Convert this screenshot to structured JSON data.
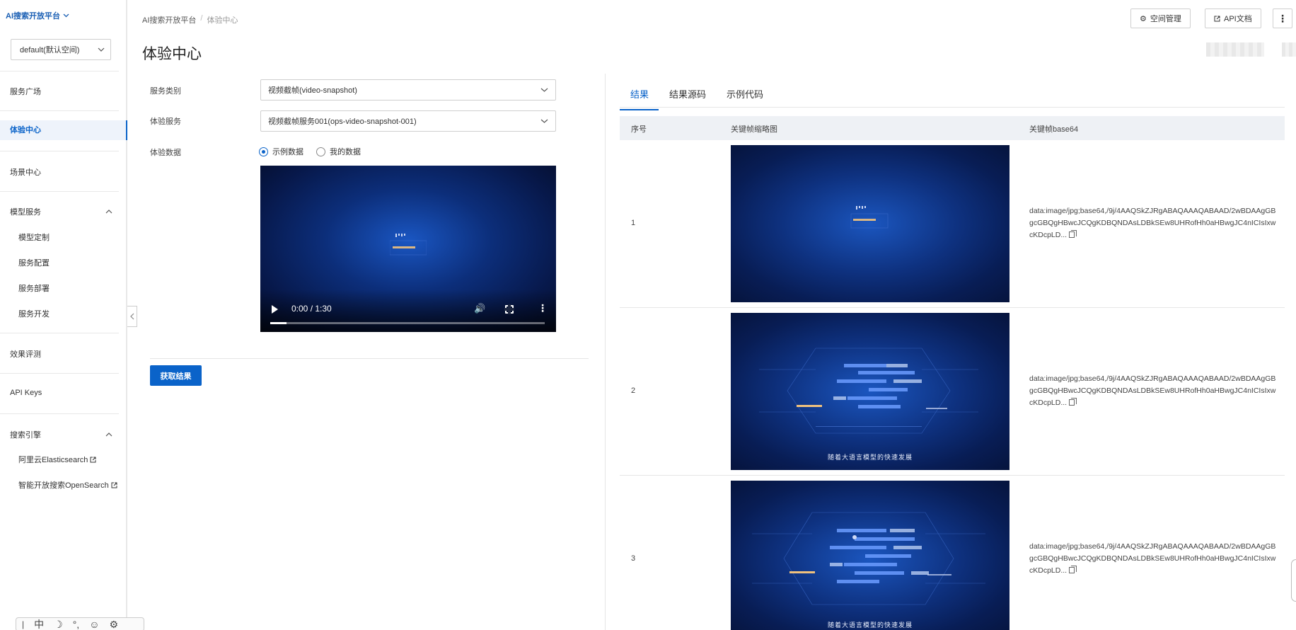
{
  "sidebar": {
    "brand": "AI搜索开放平台",
    "space": "default(默认空间)",
    "items": {
      "service_plaza": "服务广场",
      "experience_center": "体验中心",
      "scene_center": "场景中心",
      "model_service": "模型服务",
      "model_custom": "模型定制",
      "service_config": "服务配置",
      "service_deploy": "服务部署",
      "service_dev": "服务开发",
      "eval": "效果评测",
      "api_keys": "API Keys",
      "search_engine": "搜索引擎",
      "elasticsearch": "阿里云Elasticsearch",
      "opensearch": "智能开放搜索OpenSearch"
    }
  },
  "header": {
    "breadcrumb_root": "AI搜索开放平台",
    "breadcrumb_sep": "/",
    "breadcrumb_current": "体验中心",
    "title": "体验中心",
    "space_manage": "空间管理",
    "api_doc": "API文档",
    "more": "⋮"
  },
  "form": {
    "service_type_label": "服务类别",
    "service_type_value": "视频截帧(video-snapshot)",
    "service_label": "体验服务",
    "service_value": "视频截帧服务001(ops-video-snapshot-001)",
    "data_label": "体验数据",
    "radio_sample": "示例数据",
    "radio_mine": "我的数据",
    "video_time": "0:00 / 1:30",
    "video_progress": 0.06,
    "submit": "获取结果"
  },
  "results": {
    "tabs": [
      "结果",
      "结果源码",
      "示例代码"
    ],
    "columns": [
      "序号",
      "关键帧缩略图",
      "关键帧base64"
    ],
    "rows": [
      {
        "index": "1",
        "base64": "data:image/jpg;base64,/9j/4AAQSkZJRgABAQAAAQABAAD/2wBDAAgGBgcGBQgHBwcJCQgKDBQNDAsLDBkSEw8UHRofHh0aHBwgJC4nICIsIxwcKDcpLD...",
        "caption": ""
      },
      {
        "index": "2",
        "base64": "data:image/jpg;base64,/9j/4AAQSkZJRgABAQAAAQABAAD/2wBDAAgGBgcGBQgHBwcJCQgKDBQNDAsLDBkSEw8UHRofHh0aHBwgJC4nICIsIxwcKDcpLD...",
        "caption": "随着大语言模型的快速发展"
      },
      {
        "index": "3",
        "base64": "data:image/jpg;base64,/9j/4AAQSkZJRgABAQAAAQABAAD/2wBDAAgGBgcGBQgHBwcJCQgKDBQNDAsLDBkSEw8UHRofHh0aHBwgJC4nICIsIxwcKDcpLD...",
        "caption": "随着大语言模型的快速发展"
      }
    ]
  },
  "ime": {
    "lang": "中"
  }
}
